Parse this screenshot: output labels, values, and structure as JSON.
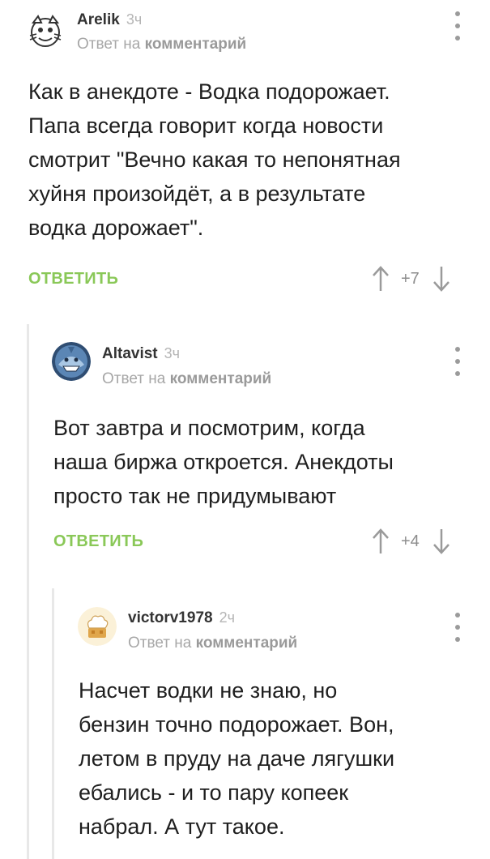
{
  "comments": [
    {
      "author": "Arelik",
      "time": "3ч",
      "reply_prefix": "Ответ на",
      "reply_target": "комментарий",
      "body": [
        "Как в анекдоте - Водка подорожает.",
        "Папа всегда говорит когда новости",
        "смотрит \"Вечно какая то непонятная",
        "хуйня произойдёт, а в результате",
        "водка дорожает\"."
      ],
      "reply_label": "ОТВЕТИТЬ",
      "rating": "+7",
      "avatar_icon": "cartoon-face-avatar-icon"
    },
    {
      "author": "Altavist",
      "time": "3ч",
      "reply_prefix": "Ответ на",
      "reply_target": "комментарий",
      "body": [
        "Вот завтра и посмотрим, когда",
        "наша биржа откроется. Анекдоты",
        "просто так не придумывают"
      ],
      "reply_label": "ОТВЕТИТЬ",
      "rating": "+4",
      "avatar_icon": "shark-avatar-icon"
    },
    {
      "author": "victorv1978",
      "time": "2ч",
      "reply_prefix": "Ответ на",
      "reply_target": "комментарий",
      "body": [
        "Насчет водки не знаю, но",
        "бензин точно подорожает. Вон,",
        "летом в пруду на даче лягушки",
        "ебались - и то пару копеек",
        "набрал. А тут такое."
      ],
      "avatar_icon": "chef-hat-avatar-icon"
    }
  ],
  "colors": {
    "accent_green": "#8ac858",
    "muted_text": "#a7a7a7",
    "thread_line": "#e8e8e8"
  },
  "icons": {
    "more": "more-vertical-icon",
    "upvote": "arrow-up-icon",
    "downvote": "arrow-down-icon"
  }
}
